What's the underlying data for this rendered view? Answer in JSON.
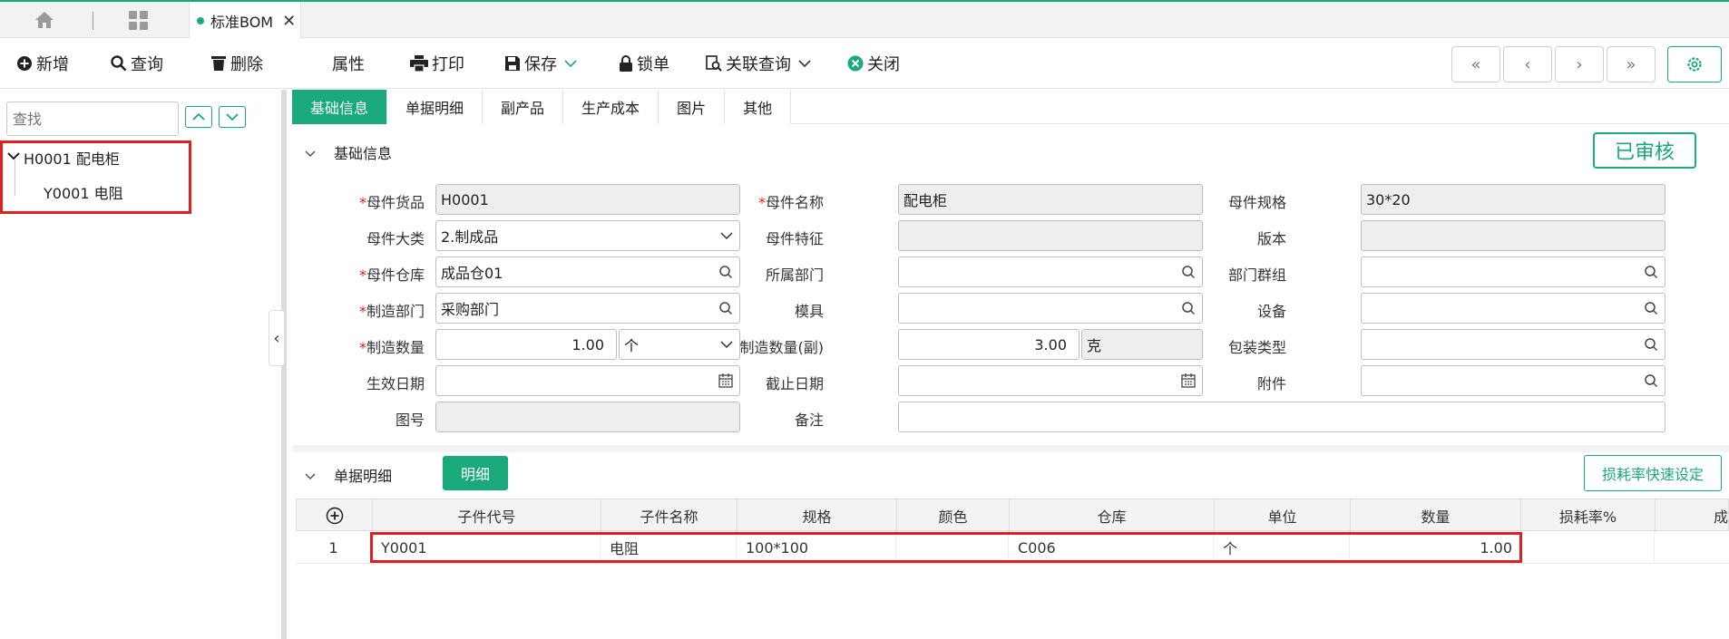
{
  "tabbar": {
    "doc_tab_label": "标准BOM",
    "close_glyph": "✕"
  },
  "toolbar": {
    "add": "新增",
    "query": "查询",
    "delete": "删除",
    "props": "属性",
    "print": "打印",
    "save": "保存",
    "lock": "锁单",
    "related": "关联查询",
    "close": "关闭"
  },
  "nav": {
    "first": "«",
    "prev": "‹",
    "next": "›",
    "last": "»"
  },
  "tree": {
    "search_placeholder": "查找",
    "root": "H0001 配电柜",
    "child": "Y0001 电阻"
  },
  "tabs": [
    "基础信息",
    "单据明细",
    "副产品",
    "生产成本",
    "图片",
    "其他"
  ],
  "section_basic": "基础信息",
  "status_badge": "已审核",
  "form": {
    "parent_item": {
      "label": "母件货品",
      "value": "H0001"
    },
    "parent_name": {
      "label": "母件名称",
      "value": "配电柜"
    },
    "parent_spec": {
      "label": "母件规格",
      "value": "30*20"
    },
    "parent_category": {
      "label": "母件大类",
      "value": "2.制成品"
    },
    "parent_feature": {
      "label": "母件特征",
      "value": ""
    },
    "version": {
      "label": "版本",
      "value": ""
    },
    "parent_warehouse": {
      "label": "母件仓库",
      "value": "成品仓01"
    },
    "dept": {
      "label": "所属部门",
      "value": ""
    },
    "dept_group": {
      "label": "部门群组",
      "value": ""
    },
    "mfg_dept": {
      "label": "制造部门",
      "value": "采购部门"
    },
    "mold": {
      "label": "模具",
      "value": ""
    },
    "equipment": {
      "label": "设备",
      "value": ""
    },
    "mfg_qty": {
      "label": "制造数量",
      "value": "1.00",
      "unit": "个"
    },
    "mfg_qty2": {
      "label": "制造数量(副)",
      "value": "3.00",
      "unit": "克"
    },
    "pack_type": {
      "label": "包装类型",
      "value": ""
    },
    "effective_date": {
      "label": "生效日期",
      "value": ""
    },
    "end_date": {
      "label": "截止日期",
      "value": ""
    },
    "attachment": {
      "label": "附件",
      "value": ""
    },
    "drawing_no": {
      "label": "图号",
      "value": ""
    },
    "remark": {
      "label": "备注",
      "value": ""
    }
  },
  "section_detail": "单据明细",
  "detail_btn": "明细",
  "loss_btn": "损耗率快速设定",
  "grid": {
    "columns": [
      "子件代号",
      "子件名称",
      "规格",
      "颜色",
      "仓库",
      "单位",
      "数量",
      "损耗率%",
      "成"
    ],
    "rows": [
      {
        "no": "1",
        "code": "Y0001",
        "name": "电阻",
        "spec": "100*100",
        "color": "",
        "wh": "C006",
        "unit": "个",
        "qty": "1.00",
        "loss": ""
      }
    ]
  }
}
